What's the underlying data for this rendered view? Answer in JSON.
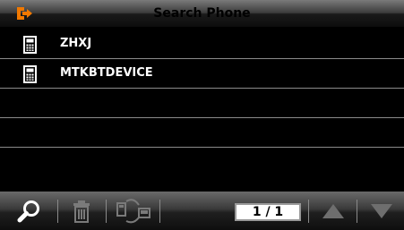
{
  "header": {
    "title": "Search Phone",
    "back_icon": "exit-arrow-icon",
    "accent_color": "#f07800"
  },
  "devices": [
    {
      "name": "ZHXJ",
      "icon": "phone-icon"
    },
    {
      "name": "MTKBTDEVICE",
      "icon": "phone-icon"
    }
  ],
  "toolbar": {
    "search_icon": "magnifier-icon",
    "delete_icon": "trash-icon",
    "pair_icon": "phone-transfer-icon",
    "page_indicator": "1 / 1",
    "up_icon": "triangle-up-icon",
    "down_icon": "triangle-down-icon"
  }
}
